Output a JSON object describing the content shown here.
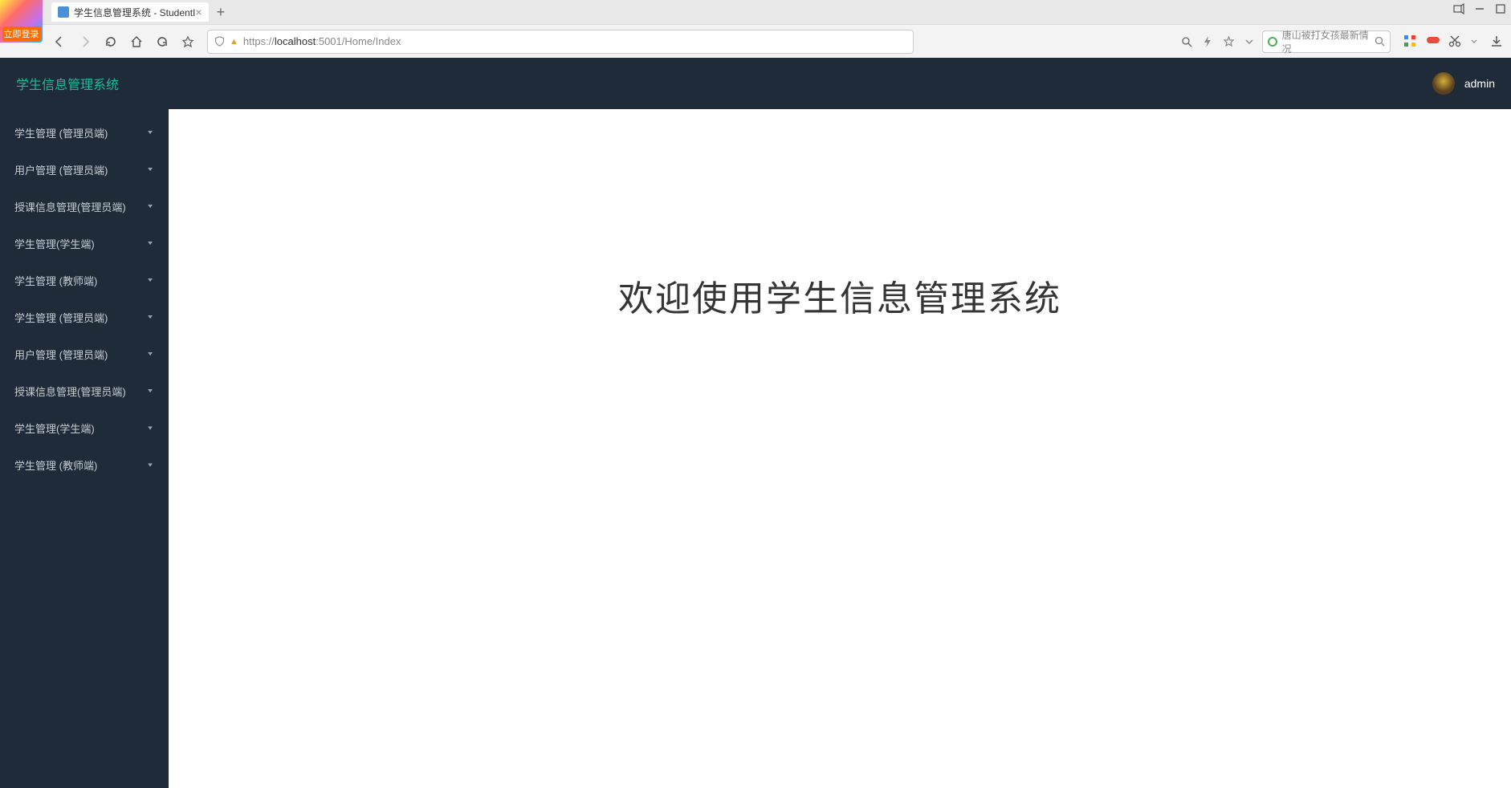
{
  "browser": {
    "logo_badge": "立即登录",
    "tab_title": "学生信息管理系统 - StudentI",
    "url_prefix": "https://",
    "url_host": "localhost",
    "url_port_path": ":5001/Home/Index",
    "search_placeholder": "唐山被打女孩最新情况",
    "new_tab": "+",
    "close_tab": "×"
  },
  "app": {
    "title": "学生信息管理系统",
    "username": "admin",
    "welcome": "欢迎使用学生信息管理系统"
  },
  "sidebar": {
    "items": [
      {
        "label": "学生管理 (管理员端)"
      },
      {
        "label": "用户管理 (管理员端)"
      },
      {
        "label": "授课信息管理(管理员端)"
      },
      {
        "label": "学生管理(学生端)"
      },
      {
        "label": "学生管理 (教师端)"
      },
      {
        "label": "学生管理 (管理员端)"
      },
      {
        "label": "用户管理 (管理员端)"
      },
      {
        "label": "授课信息管理(管理员端)"
      },
      {
        "label": "学生管理(学生端)"
      },
      {
        "label": "学生管理 (教师端)"
      }
    ]
  }
}
